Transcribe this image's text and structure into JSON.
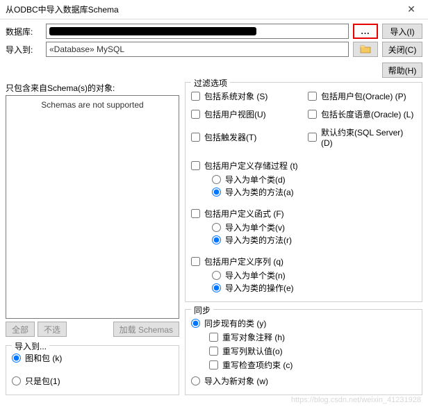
{
  "title": "从ODBC中导入数据库Schema",
  "close": "✕",
  "db_label": "数据库:",
  "import_to_label": "导入到:",
  "import_to_value": "«Database» MySQL",
  "browse_dots": "...",
  "btn_import": "导入(I)",
  "btn_close": "关闭(C)",
  "btn_help": "帮助(H)",
  "left_label": "只包含来自Schema(s)的对象:",
  "list_msg": "Schemas are not supported",
  "btn_all": "全部",
  "btn_none": "不选",
  "btn_load": "加载 Schemas",
  "import_to_group": "导入到...",
  "radio_diag_pkg": "图和包 (k)",
  "radio_pkg_only": "只是包(1)",
  "filter_title": "过滤选项",
  "chk_sysobj": "包括系统对象 (S)",
  "chk_userpkg": "包括用户包(Oracle) (P)",
  "chk_userview": "包括用户视图(U)",
  "chk_lenlang": "包括长度语意(Oracle) (L)",
  "chk_trigger": "包括触发器(T)",
  "chk_defcons": "默认约束(SQL Server) (D)",
  "chk_proc": "包括用户定义存储过程 (t)",
  "radio_proc_single": "导入为单个类(d)",
  "radio_proc_method": "导入为类的方法(a)",
  "chk_func": "包括用户定义函式 (F)",
  "radio_func_single": "导入为单个类(v)",
  "radio_func_method": "导入为类的方法(r)",
  "chk_seq": "包括用户定义序列 (q)",
  "radio_seq_single": "导入为单个类(n)",
  "radio_seq_op": "导入为类的操作(e)",
  "sync_title": "同步",
  "radio_sync_exist": "同步现有的类 (y)",
  "chk_rw_comment": "重写对象注释 (h)",
  "chk_rw_default": "重写列默认值(o)",
  "chk_rw_check": "重写检查项约束 (c)",
  "radio_import_new": "导入为新对象 (w)",
  "watermark": "https://blog.csdn.net/weixin_41231928"
}
